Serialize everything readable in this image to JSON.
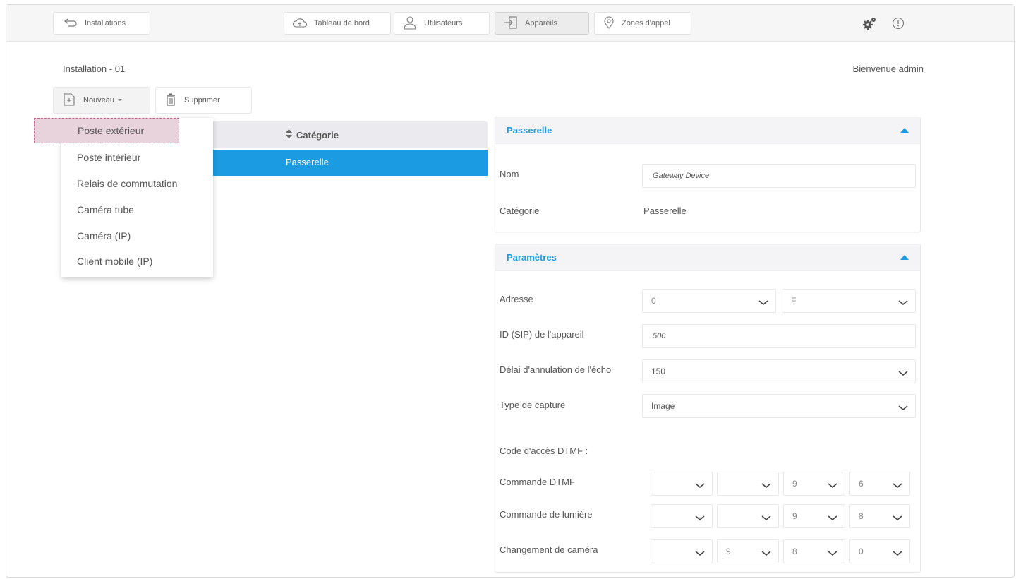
{
  "topbar": {
    "back_label": "Installations",
    "tabs": [
      {
        "label": "Tableau de bord",
        "icon": "cloud-icon",
        "active": false
      },
      {
        "label": "Utilisateurs",
        "icon": "user-icon",
        "active": false
      },
      {
        "label": "Appareils",
        "icon": "device-login-icon",
        "active": true
      },
      {
        "label": "Zones d'appel",
        "icon": "location-pin-icon",
        "active": false
      }
    ],
    "settings_icon": "gears-icon",
    "info_icon": "info-icon"
  },
  "header": {
    "installation_title": "Installation - 01",
    "welcome": "Bienvenue admin"
  },
  "toolbar": {
    "new_label": "Nouveau",
    "delete_label": "Supprimer"
  },
  "new_menu": {
    "items": [
      "Poste extérieur",
      "Poste intérieur",
      "Relais de commutation",
      "Caméra tube",
      "Caméra (IP)",
      "Client mobile (IP)"
    ],
    "highlighted_index": 0
  },
  "device_table": {
    "column_category": "Catégorie",
    "rows": [
      {
        "category": "Passerelle",
        "selected": true
      }
    ]
  },
  "panel_device": {
    "title": "Passerelle",
    "name_label": "Nom",
    "name_value": "Gateway Device",
    "category_label": "Catégorie",
    "category_value": "Passerelle"
  },
  "panel_params": {
    "title": "Paramètres",
    "address_label": "Adresse",
    "address_values": [
      "0",
      "F"
    ],
    "sip_label": "ID (SIP) de l'appareil",
    "sip_value": "500",
    "echo_label": "Délai d'annulation de l'écho",
    "echo_value": "150",
    "capture_label": "Type de capture",
    "capture_value": "Image",
    "dtmf_section_label": "Code d'accès DTMF :",
    "dtmf_command_label": "Commande DTMF",
    "dtmf_command_values": [
      "",
      "",
      "9",
      "6"
    ],
    "light_command_label": "Commande de lumière",
    "light_command_values": [
      "",
      "",
      "9",
      "8"
    ],
    "camera_change_label": "Changement de caméra",
    "camera_change_values": [
      "",
      "9",
      "8",
      "0"
    ]
  },
  "colors": {
    "accent": "#1a9be2",
    "highlight": "#e8d3dd"
  }
}
